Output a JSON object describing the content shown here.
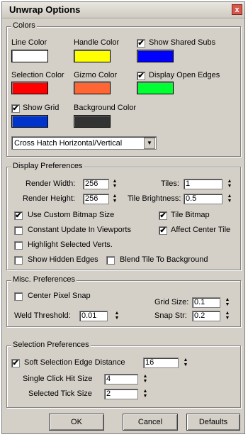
{
  "window": {
    "title": "Unwrap Options",
    "close_glyph": "x"
  },
  "colors": {
    "label": "Colors",
    "line_color": {
      "label": "Line Color",
      "value": "#ffffff"
    },
    "handle_color": {
      "label": "Handle Color",
      "value": "#ffff00"
    },
    "show_shared_subs": {
      "label": "Show Shared Subs",
      "checked": true,
      "color": "#0000ff"
    },
    "selection_color": {
      "label": "Selection Color",
      "value": "#ff0000"
    },
    "gizmo_color": {
      "label": "Gizmo Color",
      "value": "#ff6633"
    },
    "display_open_edges": {
      "label": "Display Open Edges",
      "checked": true,
      "color": "#00ff33"
    },
    "show_grid": {
      "label": "Show Grid",
      "checked": true,
      "color": "#0033cc"
    },
    "background_color": {
      "label": "Background Color",
      "value": "#333333"
    },
    "hatch_select": {
      "value": "Cross Hatch Horizontal/Vertical"
    }
  },
  "display": {
    "label": "Display Preferences",
    "render_width": {
      "label": "Render Width:",
      "value": "256"
    },
    "render_height": {
      "label": "Render Height:",
      "value": "256"
    },
    "tiles": {
      "label": "Tiles:",
      "value": "1"
    },
    "tile_brightness": {
      "label": "Tile Brightness:",
      "value": "0.5"
    },
    "use_custom_bitmap_size": {
      "label": "Use Custom Bitmap Size",
      "checked": true
    },
    "constant_update": {
      "label": "Constant Update In Viewports",
      "checked": false
    },
    "highlight_selected": {
      "label": "Highlight Selected Verts.",
      "checked": false
    },
    "show_hidden_edges": {
      "label": "Show Hidden Edges",
      "checked": false
    },
    "tile_bitmap": {
      "label": "Tile Bitmap",
      "checked": true
    },
    "affect_center_tile": {
      "label": "Affect Center Tile",
      "checked": true
    },
    "blend_tile": {
      "label": "Blend Tile To Background",
      "checked": false
    }
  },
  "misc": {
    "label": "Misc. Preferences",
    "center_pixel_snap": {
      "label": "Center Pixel Snap",
      "checked": false
    },
    "weld_threshold": {
      "label": "Weld Threshold:",
      "value": "0.01"
    },
    "grid_size": {
      "label": "Grid Size:",
      "value": "0.1"
    },
    "snap_str": {
      "label": "Snap Str:",
      "value": "0.2"
    }
  },
  "selection": {
    "label": "Selection Preferences",
    "soft_selection": {
      "label": "Soft Selection Edge Distance",
      "checked": true,
      "value": "16"
    },
    "single_click": {
      "label": "Single Click Hit Size",
      "value": "4"
    },
    "selected_tick": {
      "label": "Selected Tick Size",
      "value": "2"
    }
  },
  "buttons": {
    "ok": "OK",
    "cancel": "Cancel",
    "defaults": "Defaults"
  },
  "glyphs": {
    "check": "✔",
    "up": "▲",
    "down": "▼"
  }
}
